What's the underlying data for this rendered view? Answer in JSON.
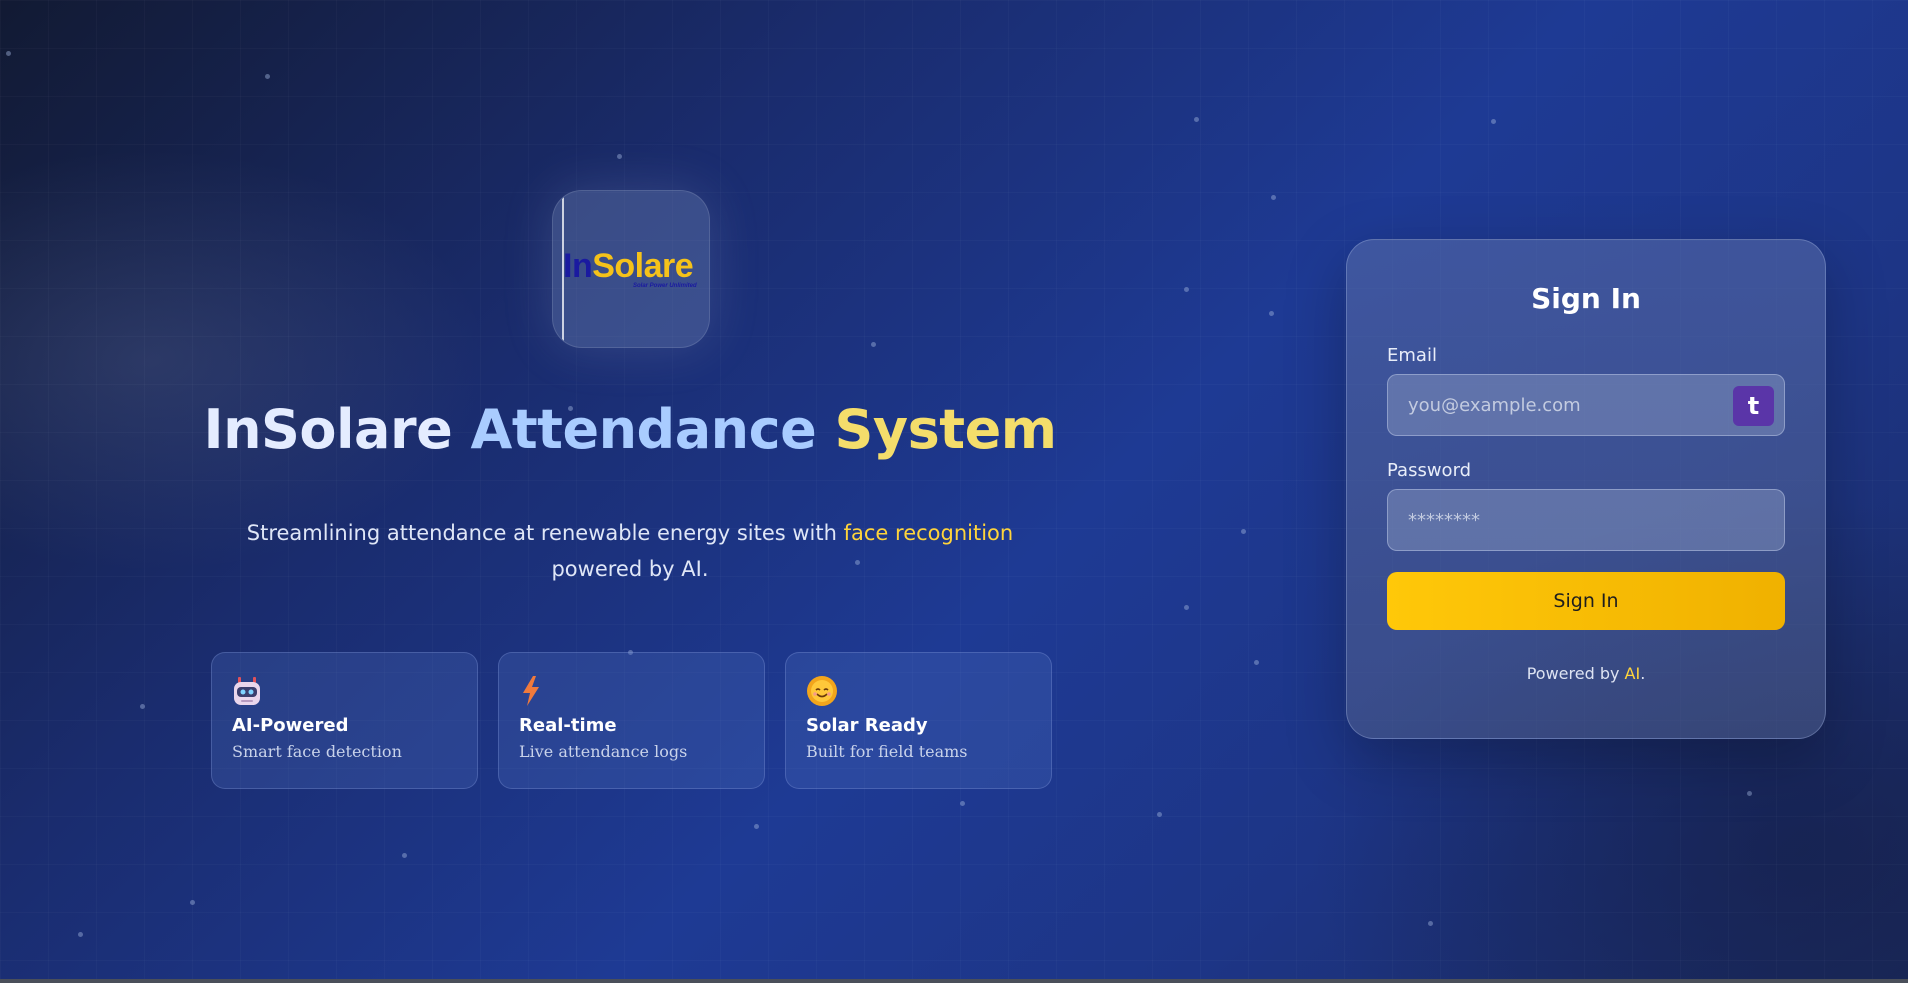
{
  "brand": {
    "logo_in": "In",
    "logo_solare": "Solare",
    "logo_tagline": "Solar Power Unlimited"
  },
  "hero": {
    "title_word1": "InSolare",
    "title_word2": "Attendance",
    "title_word3": "System",
    "subtitle_pre": "Streamlining attendance at renewable energy sites with ",
    "subtitle_highlight": "face recognition",
    "subtitle_post": " powered by AI."
  },
  "features": [
    {
      "icon": "robot-icon",
      "title": "AI-Powered",
      "description": "Smart face detection"
    },
    {
      "icon": "lightning-icon",
      "title": "Real-time",
      "description": "Live attendance logs"
    },
    {
      "icon": "sun-icon",
      "title": "Solar Ready",
      "description": "Built for field teams"
    }
  ],
  "signin": {
    "title": "Sign In",
    "email_label": "Email",
    "email_placeholder": "you@example.com",
    "email_value": "",
    "email_badge": "t",
    "password_label": "Password",
    "password_placeholder": "********",
    "password_value": "",
    "button_label": "Sign In",
    "powered_pre": "Powered by ",
    "powered_ai": "AI",
    "powered_post": "."
  },
  "colors": {
    "accent_yellow": "#ffc809",
    "highlight": "#ffd43b",
    "badge_purple": "#5a35a8"
  }
}
